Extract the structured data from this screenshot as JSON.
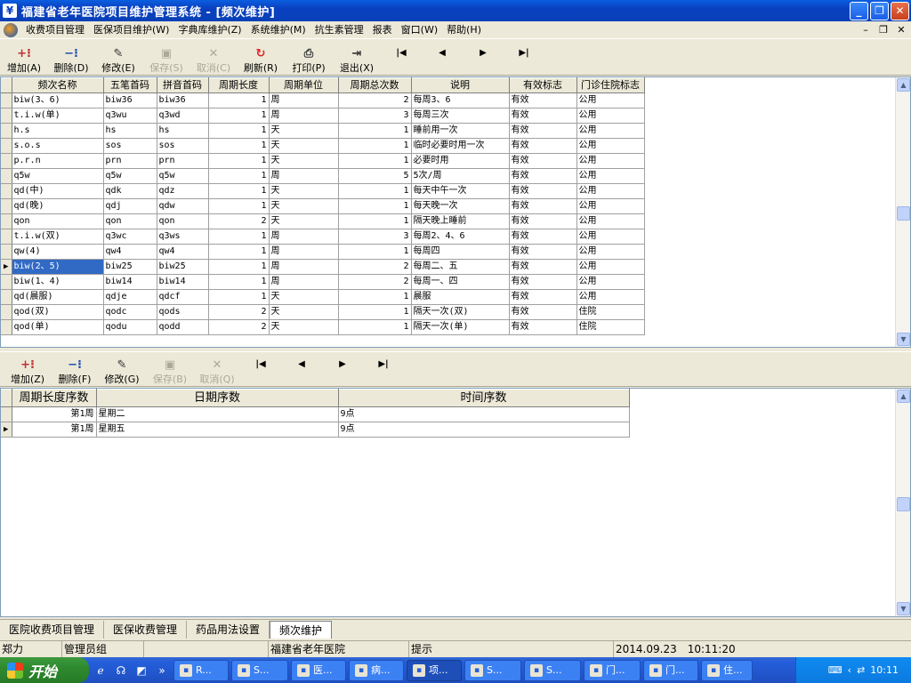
{
  "titlebar": {
    "title": "福建省老年医院项目维护管理系统 - [频次维护]",
    "icon": "¥"
  },
  "menubar": {
    "items": [
      "收费项目管理",
      "医保项目维护(W)",
      "字典库维护(Z)",
      "系统维护(M)",
      "抗生素管理",
      "报表",
      "窗口(W)",
      "帮助(H)"
    ]
  },
  "toolbar1": {
    "add": "增加(A)",
    "delete": "删除(D)",
    "edit": "修改(E)",
    "save": "保存(S)",
    "cancel": "取消(C)",
    "refresh": "刷新(R)",
    "print": "打印(P)",
    "exit": "退出(X)"
  },
  "grid1": {
    "columns": [
      "频次名称",
      "五笔首码",
      "拼音首码",
      "周期长度",
      "周期单位",
      "周期总次数",
      "说明",
      "有效标志",
      "门诊住院标志"
    ],
    "rows": [
      [
        "biw(3、6)",
        "biw36",
        "biw36",
        "1",
        "周",
        "2",
        "每周3、6",
        "有效",
        "公用"
      ],
      [
        "t.i.w(单)",
        "q3wu",
        "q3wd",
        "1",
        "周",
        "3",
        "每周三次",
        "有效",
        "公用"
      ],
      [
        "h.s",
        "hs",
        "hs",
        "1",
        "天",
        "1",
        "睡前用一次",
        "有效",
        "公用"
      ],
      [
        "s.o.s",
        "sos",
        "sos",
        "1",
        "天",
        "1",
        "临时必要时用一次",
        "有效",
        "公用"
      ],
      [
        "p.r.n",
        "prn",
        "prn",
        "1",
        "天",
        "1",
        "必要时用",
        "有效",
        "公用"
      ],
      [
        "q5w",
        "q5w",
        "q5w",
        "1",
        "周",
        "5",
        "5次/周",
        "有效",
        "公用"
      ],
      [
        "qd(中)",
        "qdk",
        "qdz",
        "1",
        "天",
        "1",
        "每天中午一次",
        "有效",
        "公用"
      ],
      [
        "qd(晚)",
        "qdj",
        "qdw",
        "1",
        "天",
        "1",
        "每天晚一次",
        "有效",
        "公用"
      ],
      [
        "qon",
        "qon",
        "qon",
        "2",
        "天",
        "1",
        "隔天晚上睡前",
        "有效",
        "公用"
      ],
      [
        "t.i.w(双)",
        "q3wc",
        "q3ws",
        "1",
        "周",
        "3",
        "每周2、4、6",
        "有效",
        "公用"
      ],
      [
        "qw(4)",
        "qw4",
        "qw4",
        "1",
        "周",
        "1",
        "每周四",
        "有效",
        "公用"
      ],
      [
        "biw(2、5)",
        "biw25",
        "biw25",
        "1",
        "周",
        "2",
        "每周二、五",
        "有效",
        "公用"
      ],
      [
        "biw(1、4)",
        "biw14",
        "biw14",
        "1",
        "周",
        "2",
        "每周一、四",
        "有效",
        "公用"
      ],
      [
        "qd(晨服)",
        "qdje",
        "qdcf",
        "1",
        "天",
        "1",
        "晨服",
        "有效",
        "公用"
      ],
      [
        "qod(双)",
        "qodc",
        "qods",
        "2",
        "天",
        "1",
        "隔天一次(双)",
        "有效",
        "住院"
      ],
      [
        "qod(单)",
        "qodu",
        "qodd",
        "2",
        "天",
        "1",
        "隔天一次(单)",
        "有效",
        "住院"
      ]
    ],
    "selected_row": 11
  },
  "toolbar2": {
    "add": "增加(Z)",
    "delete": "删除(F)",
    "edit": "修改(G)",
    "save": "保存(B)",
    "cancel": "取消(Q)"
  },
  "grid2": {
    "columns": [
      "周期长度序数",
      "日期序数",
      "时间序数"
    ],
    "rows": [
      [
        "第1周",
        "星期二",
        "9点"
      ],
      [
        "第1周",
        "星期五",
        "9点"
      ]
    ],
    "selected_row": 1
  },
  "tabs": [
    "医院收费项目管理",
    "医保收费管理",
    "药品用法设置",
    "频次维护"
  ],
  "active_tab": "频次维护",
  "statusbar": {
    "user": "郑力",
    "role": "管理员组",
    "hospital": "福建省老年医院",
    "hint": "提示",
    "datetime": "2014.09.23　10:11:20"
  },
  "taskbar": {
    "start": "开始",
    "tasks": [
      "R...",
      "S...",
      "医...",
      "病...",
      "项...",
      "S...",
      "S...",
      "门...",
      "门...",
      "住..."
    ],
    "active_task": 4,
    "clock": "10:11"
  }
}
